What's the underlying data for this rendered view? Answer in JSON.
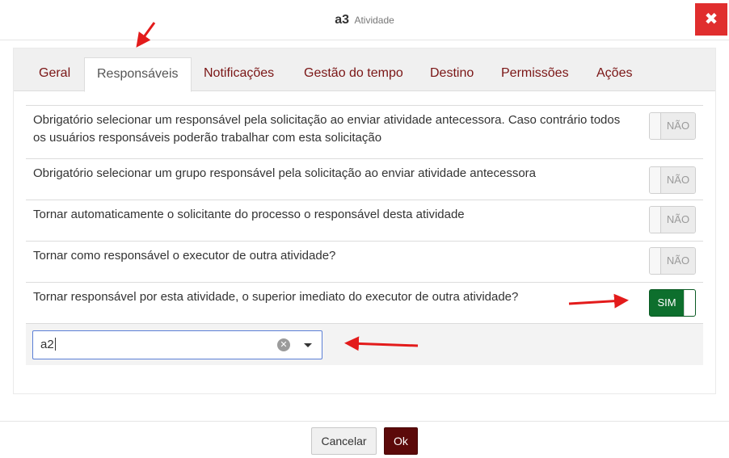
{
  "dialog": {
    "title": "a3",
    "subtitle": "Atividade",
    "close_glyph": "✖"
  },
  "tabs": [
    {
      "label": "Geral",
      "active": false
    },
    {
      "label": "Responsáveis",
      "active": true
    },
    {
      "label": "Notificações",
      "active": false
    },
    {
      "label": "Gestão do tempo",
      "active": false
    },
    {
      "label": "Destino",
      "active": false
    },
    {
      "label": "Permissões",
      "active": false
    },
    {
      "label": "Ações",
      "active": false
    }
  ],
  "settings": [
    {
      "label": "Obrigatório selecionar um responsável pela solicitação ao enviar atividade antecessora. Caso contrário todos os usuários responsáveis poderão trabalhar com esta solicitação",
      "toggle": "NÃO",
      "on": false
    },
    {
      "label": "Obrigatório selecionar um grupo responsável pela solicitação ao enviar atividade antecessora",
      "toggle": "NÃO",
      "on": false
    },
    {
      "label": "Tornar automaticamente o solicitante do processo o responsável desta atividade",
      "toggle": "NÃO",
      "on": false
    },
    {
      "label": "Tornar como responsável o executor de outra atividade?",
      "toggle": "NÃO",
      "on": false
    },
    {
      "label": "Tornar responsável por esta atividade, o superior imediato do executor de outra atividade?",
      "toggle": "SIM",
      "on": true
    }
  ],
  "activity_select": {
    "value": "a2",
    "clear_icon": "clear-circle-icon",
    "caret_icon": "caret-down-icon"
  },
  "footer": {
    "cancel_label": "Cancelar",
    "ok_label": "Ok"
  },
  "colors": {
    "tab_text": "#7a1515",
    "toggle_on": "#0d6f2d",
    "ok_button": "#5c0a0a",
    "close_button": "#e02e2e",
    "annotation_arrow": "#e31b1b"
  }
}
